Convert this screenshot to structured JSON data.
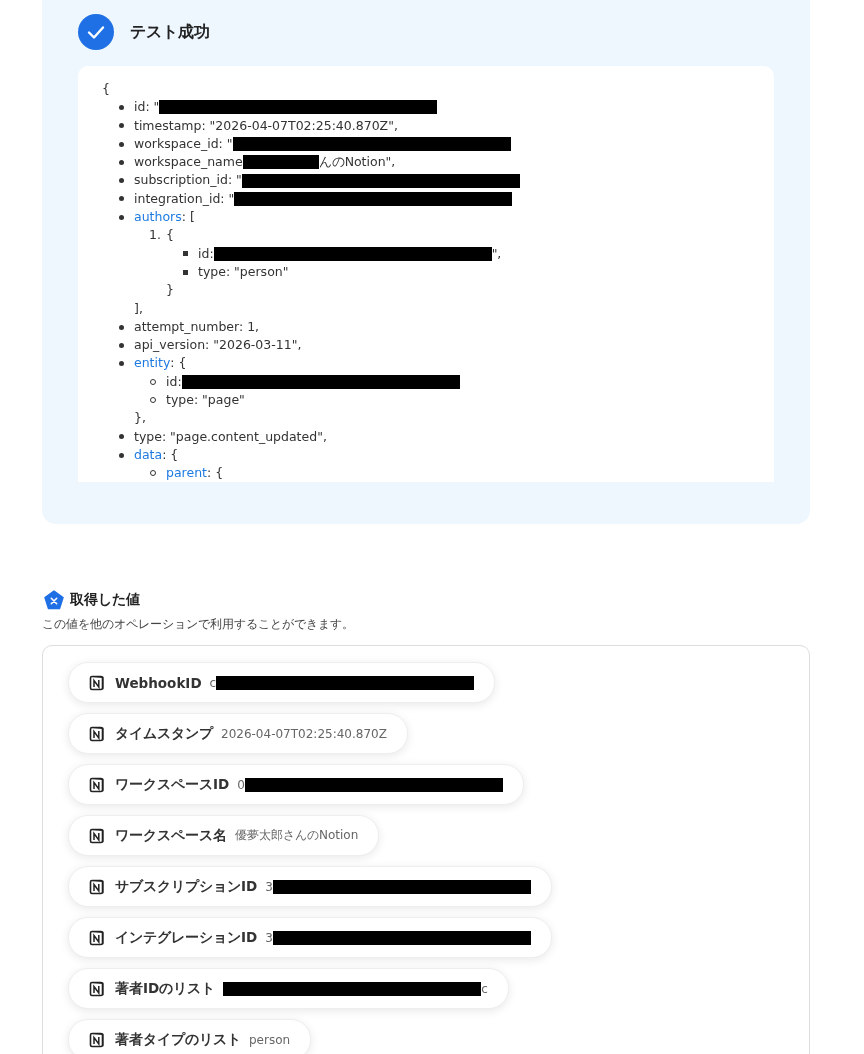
{
  "result": {
    "title": "テスト成功",
    "code": {
      "open": "{",
      "items": [
        {
          "parts": [
            {
              "kind": "text",
              "text": "id: \""
            },
            {
              "kind": "redacted"
            }
          ]
        },
        {
          "parts": [
            {
              "kind": "text",
              "text": "timestamp: \"2026-04-07T02:25:40.870Z\","
            }
          ]
        },
        {
          "parts": [
            {
              "kind": "text",
              "text": "workspace_id: \""
            },
            {
              "kind": "redacted"
            }
          ]
        },
        {
          "parts": [
            {
              "kind": "text",
              "text": "workspace_name"
            },
            {
              "kind": "short_redacted"
            },
            {
              "kind": "text",
              "text": "んのNotion\","
            }
          ]
        },
        {
          "parts": [
            {
              "kind": "text",
              "text": "subscription_id: \""
            },
            {
              "kind": "redacted"
            }
          ]
        },
        {
          "parts": [
            {
              "kind": "text",
              "text": "integration_id: \""
            },
            {
              "kind": "redacted"
            }
          ]
        },
        {
          "parts": [
            {
              "kind": "link",
              "text": "authors"
            },
            {
              "kind": "text",
              "text": ": ["
            }
          ],
          "close": "],",
          "children": [
            {
              "number": "1.",
              "parts": [
                {
                  "kind": "text",
                  "text": "{"
                }
              ],
              "close": "}",
              "children": [
                {
                  "parts": [
                    {
                      "kind": "text",
                      "text": "id:"
                    },
                    {
                      "kind": "redacted"
                    },
                    {
                      "kind": "text",
                      "text": "\","
                    }
                  ]
                },
                {
                  "parts": [
                    {
                      "kind": "text",
                      "text": "type: \"person\""
                    }
                  ]
                }
              ]
            }
          ]
        },
        {
          "parts": [
            {
              "kind": "text",
              "text": "attempt_number: 1,"
            }
          ]
        },
        {
          "parts": [
            {
              "kind": "text",
              "text": "api_version: \"2026-03-11\","
            }
          ]
        },
        {
          "parts": [
            {
              "kind": "link",
              "text": "entity"
            },
            {
              "kind": "text",
              "text": ": {"
            }
          ],
          "close": "},",
          "children": [
            {
              "parts": [
                {
                  "kind": "text",
                  "text": "id:"
                },
                {
                  "kind": "redacted"
                }
              ]
            },
            {
              "parts": [
                {
                  "kind": "text",
                  "text": "type: \"page\""
                }
              ]
            }
          ]
        },
        {
          "parts": [
            {
              "kind": "text",
              "text": "type: \"page.content_updated\","
            }
          ]
        },
        {
          "parts": [
            {
              "kind": "link",
              "text": "data"
            },
            {
              "kind": "text",
              "text": ": {"
            }
          ],
          "children": [
            {
              "parts": [
                {
                  "kind": "link",
                  "text": "parent"
                },
                {
                  "kind": "text",
                  "text": ": {"
                }
              ]
            }
          ]
        }
      ]
    }
  },
  "values": {
    "title": "取得した値",
    "description": "この値を他のオペレーションで利用することができます。",
    "items": [
      {
        "label": "WebhookID",
        "parts": [
          {
            "kind": "text",
            "text": "c"
          },
          {
            "kind": "redacted"
          }
        ]
      },
      {
        "label": "タイムスタンプ",
        "parts": [
          {
            "kind": "text",
            "text": "2026-04-07T02:25:40.870Z"
          }
        ]
      },
      {
        "label": "ワークスペースID",
        "parts": [
          {
            "kind": "text",
            "text": "0"
          },
          {
            "kind": "redacted"
          }
        ]
      },
      {
        "label": "ワークスペース名",
        "parts": [
          {
            "kind": "text",
            "text": "優夢太郎さんのNotion"
          }
        ]
      },
      {
        "label": "サブスクリプションID",
        "parts": [
          {
            "kind": "text",
            "text": "3"
          },
          {
            "kind": "redacted"
          }
        ]
      },
      {
        "label": "インテグレーションID",
        "parts": [
          {
            "kind": "text",
            "text": "3"
          },
          {
            "kind": "redacted"
          }
        ]
      },
      {
        "label": "著者IDのリスト",
        "parts": [
          {
            "kind": "redacted"
          },
          {
            "kind": "text",
            "text": "c"
          }
        ]
      },
      {
        "label": "著者タイプのリスト",
        "parts": [
          {
            "kind": "text",
            "text": "person"
          }
        ]
      }
    ]
  }
}
